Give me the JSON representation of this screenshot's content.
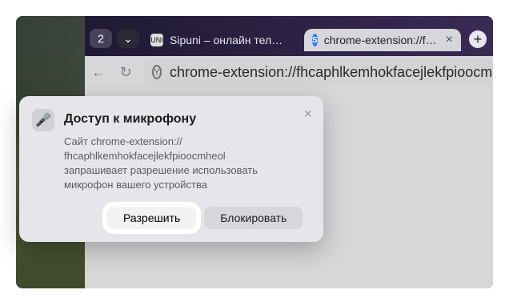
{
  "tabs": {
    "counter": "2",
    "inactive_title": "Sipuni – онлайн телефония",
    "active_title": "chrome-extension://fhcaphlkemhokfacejlekfpioocmheol",
    "close_label": "×",
    "new_tab_label": "+"
  },
  "toolbar": {
    "back_icon": "←",
    "reload_icon": "↻",
    "address_icon": "Y",
    "url": "chrome-extension://fhcaphlkemhokfacejlekfpioocmheol"
  },
  "popup": {
    "title": "Доступ к микрофону",
    "desc_line1": "Сайт chrome-extension://",
    "desc_line2": "fhcaphlkemhokfacejlekfpioocmheol",
    "desc_line3": "запрашивает разрешение использовать",
    "desc_line4": "микрофон вашего устройства",
    "allow_label": "Разрешить",
    "block_label": "Блокировать",
    "close_label": "×"
  }
}
